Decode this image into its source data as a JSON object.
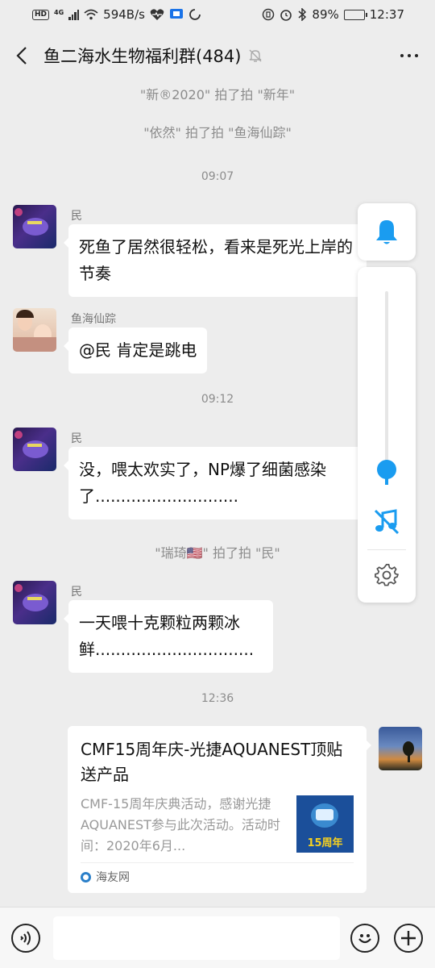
{
  "status_bar": {
    "hd_label": "HD",
    "net_label": "4G",
    "speed": "594B/s",
    "battery": "89%",
    "battery_level": 0.89,
    "time": "12:37"
  },
  "header": {
    "title": "鱼二海水生物福利群(484)"
  },
  "chat": {
    "system_messages": [
      "\"新®2020\" 拍了拍 \"新年\"",
      "\"依然\" 拍了拍 \"鱼海仙踪\"",
      "\"瑞琦🇺🇸\" 拍了拍 \"民\""
    ],
    "timestamps": [
      "09:07",
      "09:12",
      "12:36"
    ],
    "messages": [
      {
        "sender": "民",
        "text": "死鱼了居然很轻松，看来是死光上岸的节奏"
      },
      {
        "sender": "鱼海仙踪",
        "text": "@民  肯定是跳电"
      },
      {
        "sender": "民",
        "text": "没，喂太欢实了，NP爆了细菌感染了............................"
      },
      {
        "sender": "民",
        "text": "一天喂十克颗粒两颗冰鲜..............................."
      }
    ]
  },
  "link_card": {
    "title": "CMF15周年庆-光捷AQUANEST顶贴送产品",
    "description": "CMF-15周年庆典活动，感谢光捷AQUANEST参与此次活动。活动时间：2020年6月...",
    "thumb_text": "15周年",
    "source": "海友网"
  },
  "volume_panel": {
    "level": 0.08,
    "accent_color": "#1a9cf0"
  },
  "input_bar": {
    "placeholder": ""
  },
  "icons": {
    "back": "chevron-left-icon",
    "mute": "bell-off-icon",
    "more": "more-icon",
    "bell": "bell-icon",
    "music_off": "music-off-icon",
    "settings": "gear-icon",
    "voice": "voice-icon",
    "emoji": "emoji-icon",
    "plus": "plus-icon"
  }
}
